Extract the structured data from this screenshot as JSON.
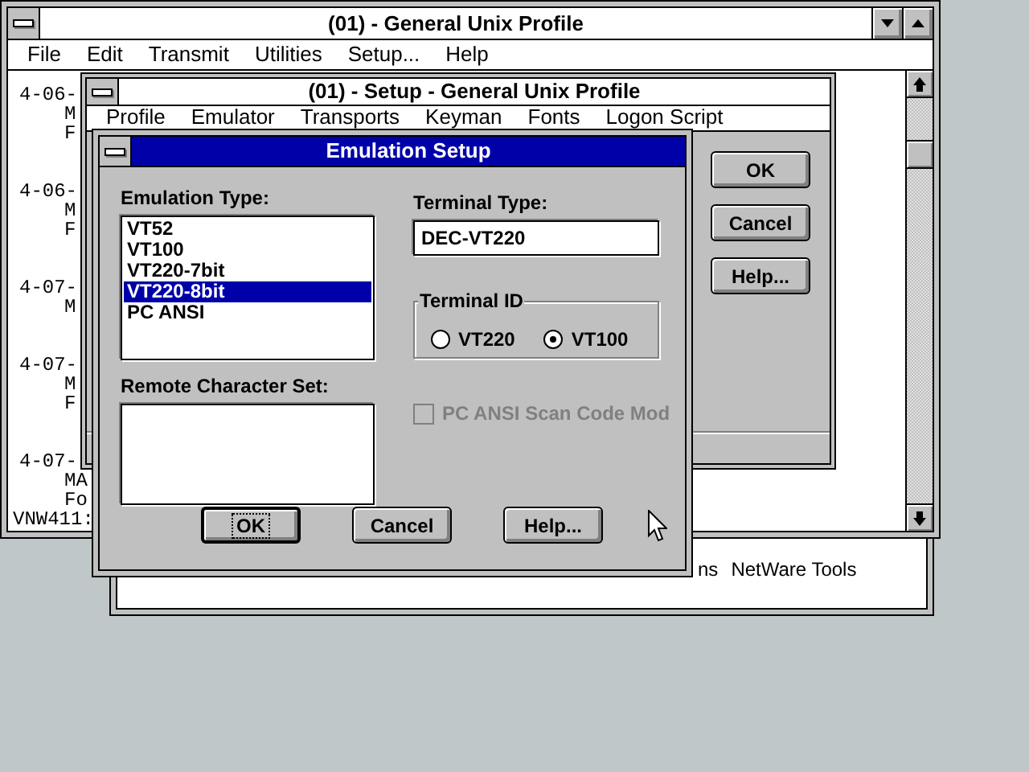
{
  "tools_window": {
    "items": [
      "ns",
      "NetWare Tools"
    ]
  },
  "terminal_window": {
    "title": "(01) - General Unix Profile",
    "menu": [
      "File",
      "Edit",
      "Transmit",
      "Utilities",
      "Setup...",
      "Help"
    ],
    "blocks": [
      {
        "date": "4-06-",
        "details": [
          "M",
          "F"
        ]
      },
      {
        "date": "4-06-",
        "details": [
          "M",
          "F"
        ]
      },
      {
        "date": "4-07-",
        "details": [
          "M"
        ]
      },
      {
        "date": "4-07-",
        "details": [
          "M",
          "F"
        ]
      },
      {
        "date": "4-07-",
        "details": [
          "MA",
          "Fo"
        ]
      }
    ],
    "prompt": "VNW411:"
  },
  "setup_window": {
    "title": "(01) - Setup - General Unix Profile",
    "menu": [
      "Profile",
      "Emulator",
      "Transports",
      "Keyman",
      "Fonts",
      "Logon Script"
    ],
    "buttons": [
      "OK",
      "Cancel",
      "Help..."
    ]
  },
  "dialog": {
    "title": "Emulation Setup",
    "emulation_type": {
      "label": "Emulation Type:",
      "items": [
        {
          "label": "VT52",
          "selected": false
        },
        {
          "label": "VT100",
          "selected": false
        },
        {
          "label": "VT220-7bit",
          "selected": false
        },
        {
          "label": "VT220-8bit",
          "selected": true
        },
        {
          "label": "PC ANSI",
          "selected": false
        }
      ]
    },
    "remote_character_set": {
      "label": "Remote Character Set:"
    },
    "terminal_type": {
      "label": "Terminal Type:",
      "value": "DEC-VT220"
    },
    "terminal_id": {
      "label": "Terminal ID",
      "options": [
        {
          "label": "VT220",
          "selected": false
        },
        {
          "label": "VT100",
          "selected": true
        }
      ]
    },
    "scan_code_mode": {
      "label": "PC ANSI Scan Code Mod",
      "checked": false,
      "disabled": true
    },
    "buttons": [
      {
        "label": "OK",
        "default": true
      },
      {
        "label": "Cancel",
        "default": false
      },
      {
        "label": "Help...",
        "default": false
      }
    ]
  }
}
